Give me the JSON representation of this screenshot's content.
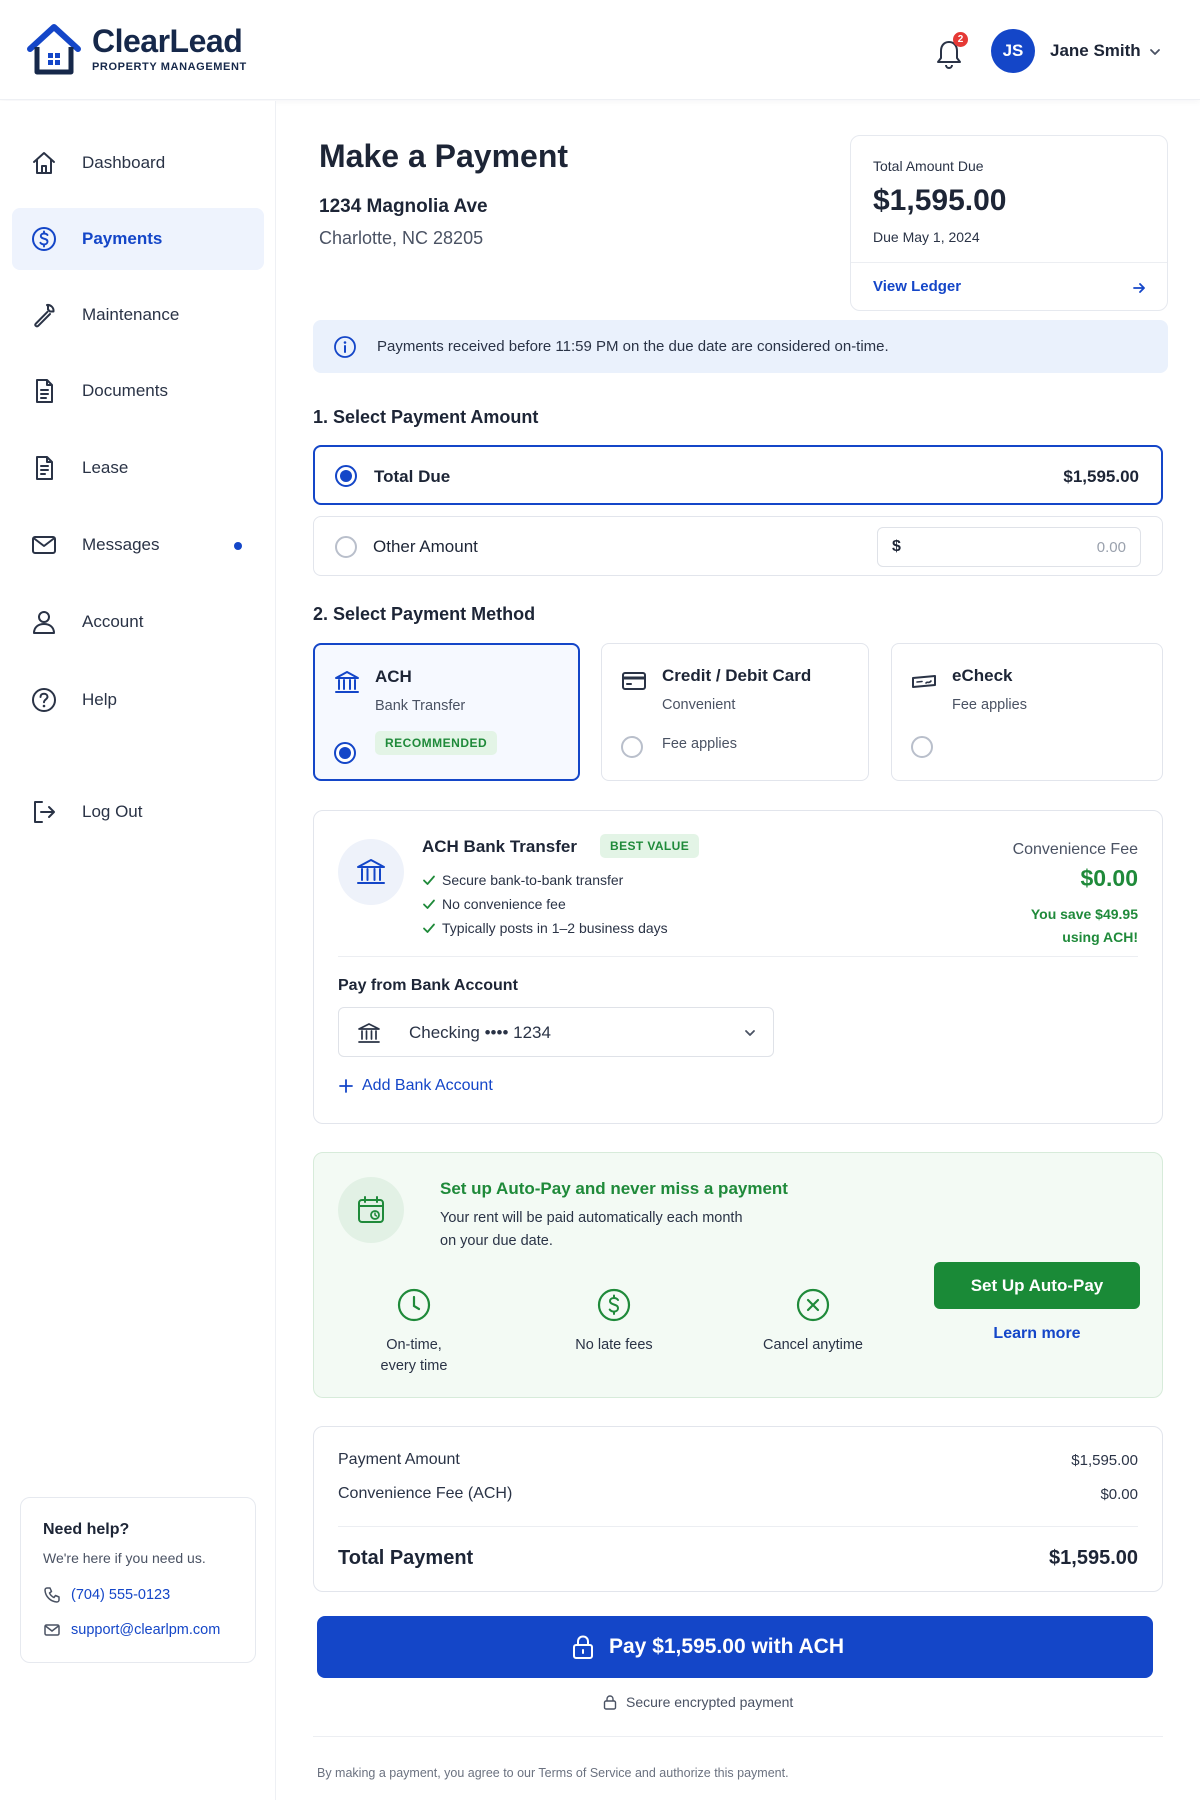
{
  "header": {
    "brand_name": "ClearLead",
    "brand_tagline": "PROPERTY MANAGEMENT",
    "notification_count": "2",
    "user_initials": "JS",
    "user_name": "Jane Smith",
    "icons": [
      "house-logo-icon",
      "bell-icon",
      "chevron-down-icon"
    ]
  },
  "sidebar": {
    "items": [
      {
        "label": "Dashboard",
        "icon": "home-icon"
      },
      {
        "label": "Payments",
        "icon": "dollar-circle-icon",
        "active": true
      },
      {
        "label": "Maintenance",
        "icon": "wrench-icon"
      },
      {
        "label": "Documents",
        "icon": "document-icon"
      },
      {
        "label": "Lease",
        "icon": "lease-icon"
      },
      {
        "label": "Messages",
        "icon": "mail-icon",
        "unread": true
      },
      {
        "label": "Account",
        "icon": "user-icon"
      },
      {
        "label": "Help",
        "icon": "help-circle-icon"
      },
      {
        "label": "Log Out",
        "icon": "logout-icon"
      }
    ],
    "help": {
      "title": "Need help?",
      "subtitle": "We're here if you need us.",
      "phone": "(704) 555-0123",
      "email": "support@clearlpm.com"
    }
  },
  "page": {
    "title": "Make a Payment",
    "address_line1": "1234 Magnolia Ave",
    "address_line2": "Charlotte, NC 28205"
  },
  "amount_due": {
    "label": "Total Amount Due",
    "amount": "$1,595.00",
    "due_date": "Due May 1, 2024",
    "ledger_link": "View Ledger"
  },
  "info_banner": "Payments received before 11:59 PM on the due date are considered on-time.",
  "amount_section": {
    "heading": "1. Select Payment Amount",
    "options": [
      {
        "label": "Total Due",
        "value": "$1,595.00",
        "selected": true
      },
      {
        "label": "Other Amount",
        "currency": "$",
        "placeholder": "0.00",
        "selected": false
      }
    ]
  },
  "method_section": {
    "heading": "2. Select Payment Method",
    "methods": [
      {
        "title": "ACH",
        "subtitle": "Bank Transfer",
        "badge": "RECOMMENDED",
        "selected": true,
        "icon": "bank-icon"
      },
      {
        "title": "Credit / Debit Card",
        "subtitle": "Convenient",
        "note": "Fee applies",
        "selected": false,
        "icon": "credit-card-icon"
      },
      {
        "title": "eCheck",
        "subtitle": "Fee applies",
        "selected": false,
        "icon": "check-icon"
      }
    ]
  },
  "ach_details": {
    "title": "ACH Bank Transfer",
    "badge": "BEST VALUE",
    "bullets": [
      "Secure bank-to-bank transfer",
      "No convenience fee",
      "Typically posts in 1–2 business days"
    ],
    "fee_label": "Convenience Fee",
    "fee_value": "$0.00",
    "savings_line1": "You save $49.95",
    "savings_line2": "using ACH!",
    "pay_from_label": "Pay from Bank Account",
    "account": "Checking •••• 1234",
    "add_account": "Add Bank Account"
  },
  "autopay": {
    "title": "Set up Auto-Pay and never miss a payment",
    "desc_line1": "Your rent will be paid automatically each month",
    "desc_line2": "on your due date.",
    "features": [
      {
        "line1": "On-time,",
        "line2": "every time",
        "icon": "clock-icon"
      },
      {
        "line1": "No late fees",
        "line2": "",
        "icon": "dollar-icon"
      },
      {
        "line1": "Cancel anytime",
        "line2": "",
        "icon": "x-circle-icon"
      }
    ],
    "button": "Set Up Auto-Pay",
    "learn_more": "Learn more"
  },
  "summary": {
    "payment_amount_label": "Payment Amount",
    "payment_amount_value": "$1,595.00",
    "fee_label": "Convenience Fee (ACH)",
    "fee_value": "$0.00",
    "total_label": "Total Payment",
    "total_value": "$1,595.00"
  },
  "pay_button": "Pay $1,595.00 with ACH",
  "secure_text": "Secure encrypted payment",
  "terms": "By making a payment, you agree to our Terms of Service and authorize this payment.",
  "colors": {
    "primary": "#1446c8",
    "success": "#1f8a3a",
    "text": "#1d2536",
    "notification": "#e53935"
  }
}
